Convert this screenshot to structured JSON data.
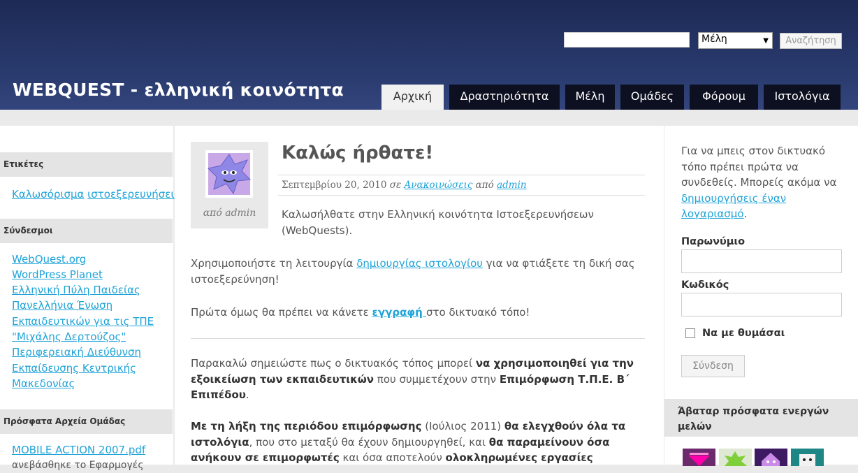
{
  "header": {
    "site_title": "WEBQUEST - ελληνική κοινότητα",
    "search_placeholder": "",
    "search_select_value": "Μέλη",
    "search_button": "Αναζήτηση",
    "tabs": [
      "Αρχική",
      "Δραστηριότητα",
      "Μέλη",
      "Ομάδες",
      "Φόρουμ",
      "Ιστολόγια"
    ],
    "active_tab": "Αρχική"
  },
  "left_sidebar": {
    "tags_title": "Ετικέτες",
    "tags": [
      "Καλωσόρισμα",
      "ιστοεξερευνήσεις"
    ],
    "links_title": "Σύνδεσμοι",
    "links": [
      "WebQuest.org",
      "WordPress Planet",
      "Ελληνική Πύλη Παιδείας",
      "Πανελλήνια Ένωση",
      "Εκπαιδευτικών για τις ΤΠΕ",
      "\"Μιχάλης Δερτούζος\"",
      "Περιφερειακή Διεύθυνση",
      "Εκπαίδευσης Κεντρικής",
      "Μακεδονίας"
    ],
    "files_title": "Πρόσφατα Αρχεία Ομάδας",
    "files": [
      "MOBILE ACTION 2007.pdf"
    ],
    "files_cut_text": "ανεβάσθηκε το Εφαρμογές"
  },
  "post": {
    "avatar_by": "από admin",
    "title": "Καλώς ήρθατε!",
    "meta_date": "Σεπτεμβρίου 20, 2010",
    "meta_in": "σε",
    "meta_category": "Ανακοινώσεις",
    "meta_by": "από",
    "meta_author": "admin",
    "intro_line1": "Καλωσήλθατε στην Ελληνική κοινότητα Ιστοεξερευνήσεων",
    "intro_line2": "(WebQuests).",
    "p1_pre": "Χρησιμοποιήστε τη λειτουργία ",
    "p1_link": "δημιουργίας ιστολογίου",
    "p1_post": " για να φτιάξετε τη δική σας",
    "p1_line2": "ιστοεξερεύνηση!",
    "p2_pre": "Πρώτα όμως θα πρέπει να κάνετε ",
    "p2_link": "εγγραφή ",
    "p2_post": "στο δικτυακό τόπο!",
    "p3_a": "Παρακαλώ σημειώστε πως ο δικτυακός τόπος μπορεί ",
    "p3_b": "να χρησιμοποιηθεί για την",
    "p3_c": "εξοικείωση των εκπαιδευτικών",
    "p3_d": " που συμμετέχουν στην ",
    "p3_e": "Επιμόρφωση Τ.Π.Ε. Β΄",
    "p3_f": "Επιπέδου",
    "p3_g": ".",
    "p4_a": "Με τη λήξη της περιόδου επιμόρφωσης",
    "p4_b": " (Ιούλιος 2011) ",
    "p4_c": "θα ελεγχθούν όλα τα",
    "p4_d": "ιστολόγια",
    "p4_e": ", που στο μεταξύ θα έχουν δημιουργηθεί,  και ",
    "p4_f": "θα παραμείνουν όσα",
    "p4_g": "ανήκουν σε επιμορφωτές",
    "p4_h": " και όσα αποτελούν ",
    "p4_i": "ολοκληρωμένες εργασίες"
  },
  "right_sidebar": {
    "intro_text": "Για να μπεις στον δικτυακό τόπο πρέπει πρώτα να συνδεθείς. Μπορείς ακόμα να ",
    "intro_link": "δημιουργήσεις έναν λογαριασμό",
    "intro_end": ".",
    "username_label": "Παρωνύμιο",
    "password_label": "Κωδικός",
    "remember_label": "Να με θυμάσαι",
    "login_button": "Σύνδεση",
    "avatars_title": "Άβαταρ πρόσφατα ενεργών μελών"
  },
  "colors": {
    "header_dark": "#1d2a55",
    "tab_bg": "#0d1020",
    "link": "#1fa3d8"
  }
}
